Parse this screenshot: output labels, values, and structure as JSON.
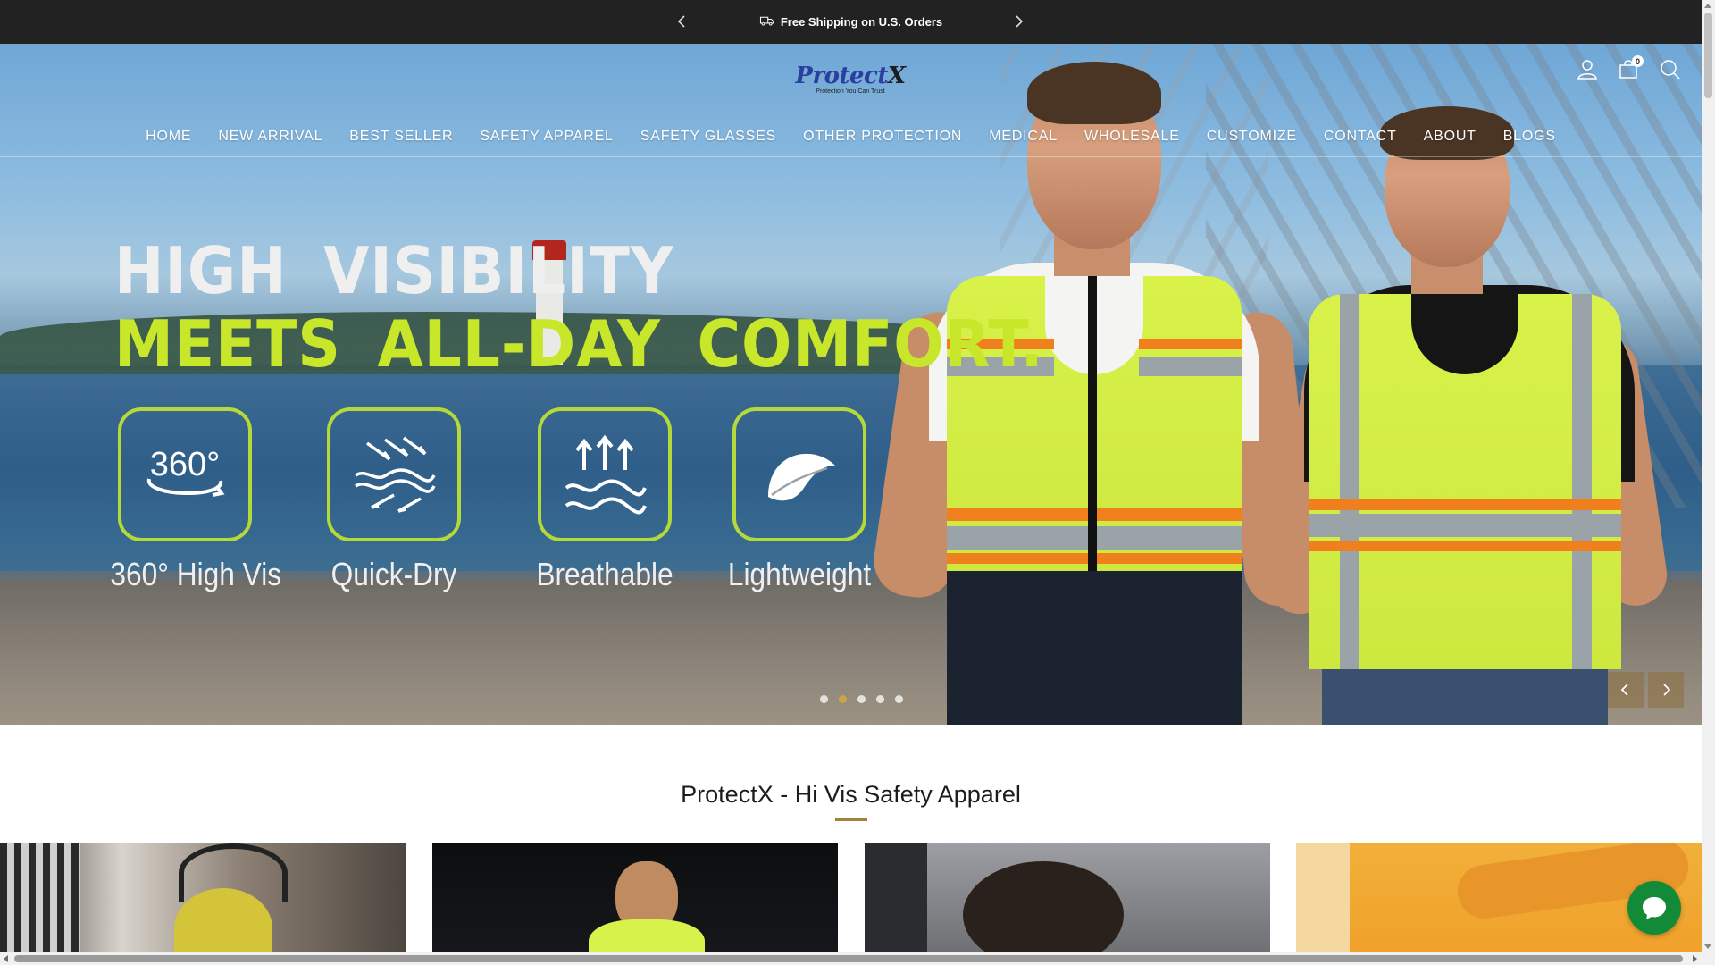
{
  "announcement": {
    "text": "Free Shipping on U.S. Orders",
    "icon": "truck-icon"
  },
  "header": {
    "logo_brand_main": "Protect",
    "logo_brand_x": "X",
    "logo_tagline": "Protection You Can Trust",
    "cart_count": "0",
    "icons": [
      "account-icon",
      "cart-icon",
      "search-icon"
    ]
  },
  "nav": {
    "items": [
      {
        "label": "HOME"
      },
      {
        "label": "NEW ARRIVAL"
      },
      {
        "label": "BEST SELLER"
      },
      {
        "label": "SAFETY APPAREL"
      },
      {
        "label": "SAFETY GLASSES"
      },
      {
        "label": "OTHER PROTECTION"
      },
      {
        "label": "MEDICAL"
      },
      {
        "label": "WHOLESALE"
      },
      {
        "label": "CUSTOMIZE"
      },
      {
        "label": "CONTACT"
      },
      {
        "label": "ABOUT"
      },
      {
        "label": "BLOGS"
      }
    ]
  },
  "hero": {
    "headline_line1": "HIGH VISIBILITY",
    "headline_line2": "MEETS ALL-DAY COMFORT.",
    "features": [
      {
        "label": "360° High Vis",
        "icon": "rotate-360-icon",
        "icon_text": "360°"
      },
      {
        "label": "Quick-Dry",
        "icon": "quick-dry-icon"
      },
      {
        "label": "Breathable",
        "icon": "breathable-icon"
      },
      {
        "label": "Lightweight",
        "icon": "leaf-icon"
      }
    ],
    "slides_total": 5,
    "active_slide": 2
  },
  "section": {
    "title": "ProtectX - Hi Vis Safety Apparel"
  },
  "colors": {
    "announcement_bg": "#222222",
    "accent_green": "#c8e62a",
    "accent_gold": "#a4823d",
    "chat_green": "#138a38"
  }
}
